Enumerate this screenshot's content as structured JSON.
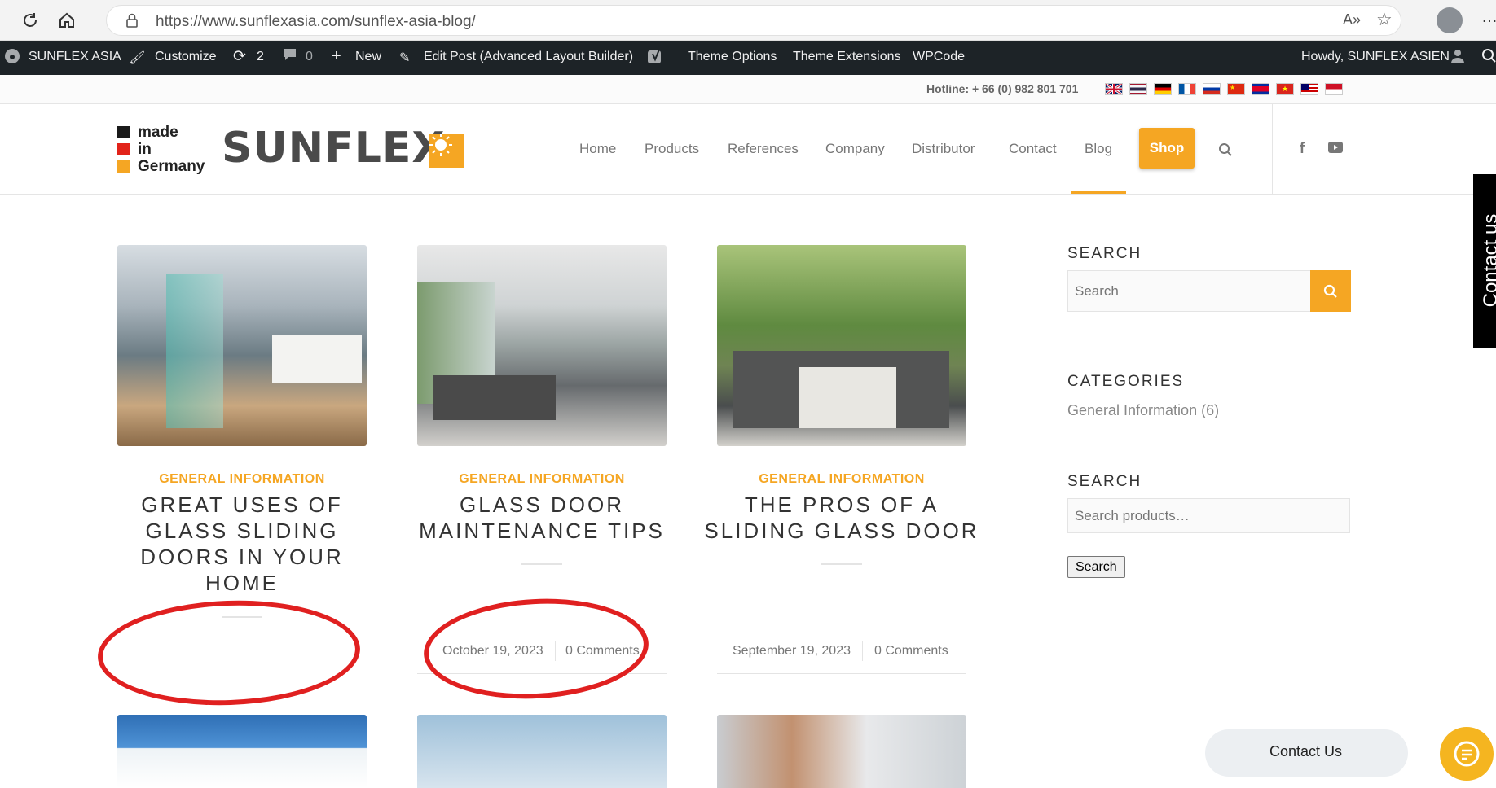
{
  "browser": {
    "url": "https://www.sunflexasia.com/sunflex-asia-blog/"
  },
  "adminbar": {
    "site_name": "SUNFLEX ASIA",
    "customize": "Customize",
    "updates_count": "2",
    "comments_count": "0",
    "new": "New",
    "edit_post": "Edit Post (Advanced Layout Builder)",
    "theme_options": "Theme Options",
    "theme_extensions": "Theme Extensions",
    "wpcode": "WPCode",
    "howdy": "Howdy, SUNFLEX ASIEN"
  },
  "topbar": {
    "hotline": "Hotline: + 66 (0) 982 801 701",
    "flags": [
      "uk-flag",
      "thai-flag",
      "german-flag",
      "french-flag",
      "russian-flag",
      "chinese-flag",
      "cambodian-flag",
      "vietnamese-flag",
      "malaysian-flag",
      "indonesian-flag"
    ]
  },
  "logo": {
    "line1": "made",
    "line2": "in",
    "line3": "Germany",
    "brand": "SUNFLEX"
  },
  "nav": {
    "items": [
      "Home",
      "Products",
      "References",
      "Company",
      "Distributor",
      "Contact",
      "Blog"
    ],
    "shop": "Shop",
    "active": "Blog"
  },
  "posts": [
    {
      "category": "GENERAL INFORMATION",
      "title_lines": [
        "GREAT USES OF",
        "GLASS SLIDING",
        "DOORS IN YOUR",
        "HOME"
      ],
      "date": "",
      "comments": ""
    },
    {
      "category": "GENERAL INFORMATION",
      "title_lines": [
        "GLASS DOOR",
        "MAINTENANCE TIPS"
      ],
      "date": "October 19, 2023",
      "comments": "0 Comments"
    },
    {
      "category": "GENERAL INFORMATION",
      "title_lines": [
        "THE PROS OF A",
        "SLIDING GLASS DOOR"
      ],
      "date": "September 19, 2023",
      "comments": "0 Comments"
    }
  ],
  "sidebar": {
    "search_heading": "SEARCH",
    "search_placeholder": "Search",
    "categories_heading": "CATEGORIES",
    "category_link": "General Information (6)",
    "product_search_heading": "SEARCH",
    "product_search_placeholder": "Search products…",
    "product_search_button": "Search"
  },
  "contact_tab": "Contact us",
  "chat": {
    "label": "Contact Us"
  },
  "colors": {
    "accent": "#f5a623",
    "admin_bar": "#1d2327",
    "annotation": "#e02020"
  }
}
